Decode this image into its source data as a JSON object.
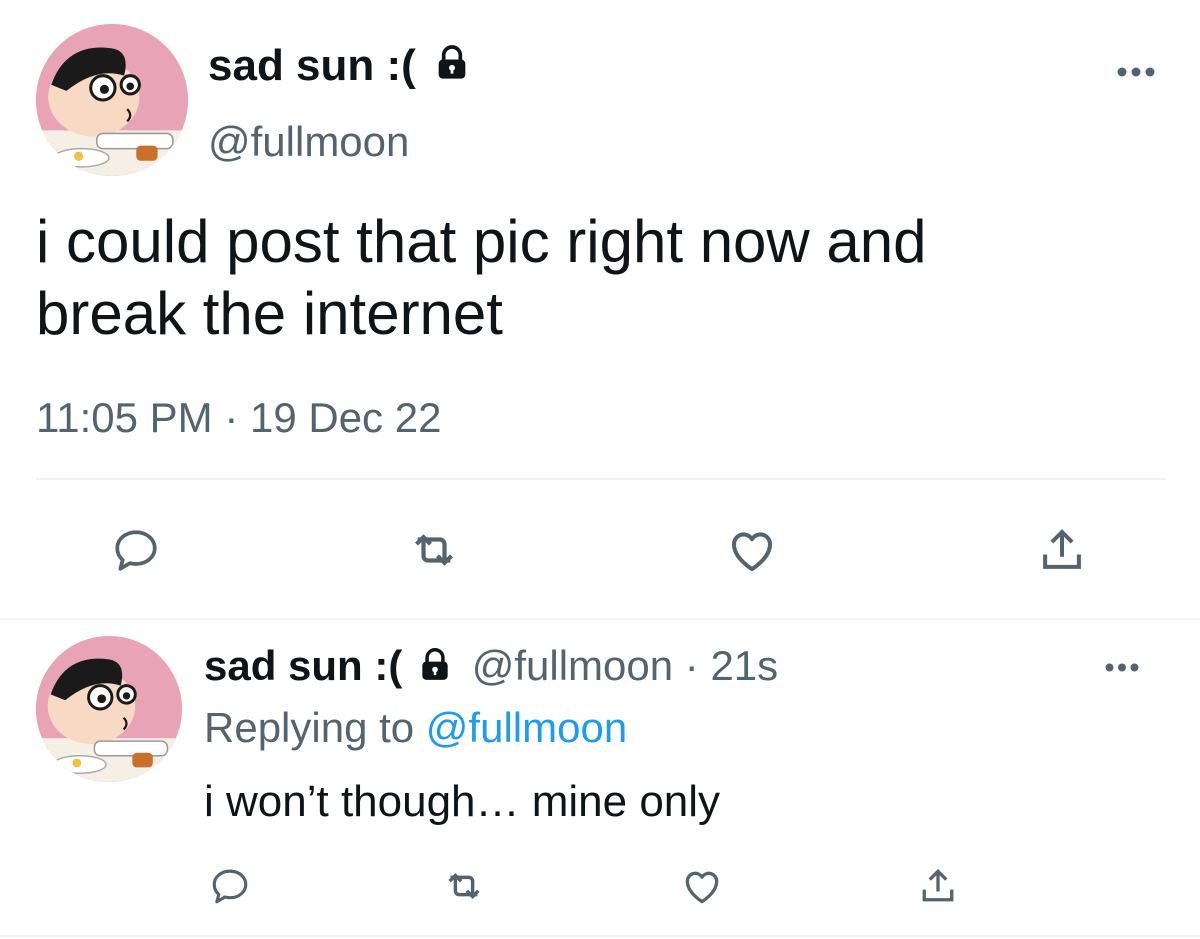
{
  "main_tweet": {
    "display_name": "sad sun :(",
    "handle": "@fullmoon",
    "text_line1": "i could post that pic right now and",
    "text_line2": "break the internet",
    "timestamp": "11:05 PM · 19 Dec 22",
    "icons": [
      "lock-icon",
      "more-icon",
      "reply-icon",
      "retweet-icon",
      "like-icon",
      "share-icon"
    ]
  },
  "reply_tweet": {
    "display_name": "sad sun :(",
    "handle": "@fullmoon",
    "separator": "·",
    "age": "21s",
    "replying_prefix": "Replying to",
    "replying_handle": "@fullmoon",
    "text": "i won’t though… mine only",
    "icons": [
      "lock-icon",
      "more-icon",
      "reply-icon",
      "retweet-icon",
      "like-icon",
      "share-icon"
    ]
  },
  "colors": {
    "text": "#0f1419",
    "muted": "#536471",
    "link": "#1d9bf0",
    "divider": "#eff3f4",
    "background": "#ffffff"
  }
}
